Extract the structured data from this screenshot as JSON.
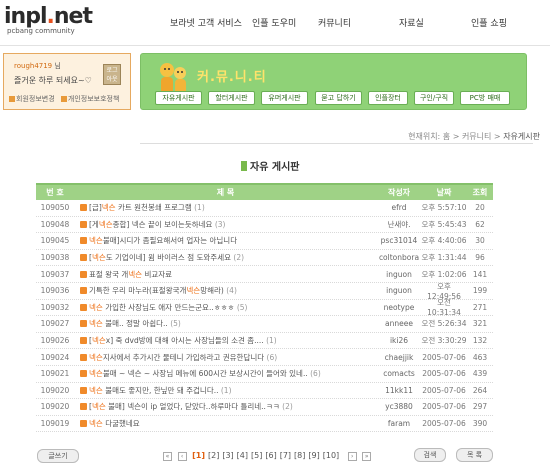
{
  "header": {
    "logo_main": "inpl",
    "logo_dot": ".",
    "logo_tld": "net",
    "logo_sub": "pcbang community",
    "nav": [
      "보라넷 고객 서비스",
      "인플 도우미",
      "커뮤니티",
      "자료실",
      "인플 쇼핑"
    ]
  },
  "login": {
    "username": "rough4719",
    "suffix": " 님",
    "greeting": "즐거운 하루 되세요~♡",
    "logout": "로그아웃",
    "link_info": "회원정보변경",
    "link_privacy": "개인정보보호정책"
  },
  "banner": {
    "title": "커.뮤.니.티",
    "tabs": [
      "자유게시판",
      "할터게시판",
      "유머게시판",
      "묻고 답하기",
      "인플장터",
      "구인/구직",
      "PC방 매매"
    ]
  },
  "breadcrumb": {
    "prefix": "현재위치:",
    "path": "홈 > 커뮤니티 > ",
    "current": "자유게시판"
  },
  "board": {
    "title": "자유 게시판",
    "columns": [
      "번 호",
      "제 목",
      "작성자",
      "날짜",
      "조회"
    ],
    "rows": [
      {
        "no": "109050",
        "pre": "[급]",
        "hl": "넥슨",
        "post": " 카트 원천봉쇄 프로그램",
        "cmt": "(1)",
        "writer": "efrd",
        "date": "오후 5:57:10",
        "hits": "20"
      },
      {
        "no": "109048",
        "pre": "[게",
        "hl": "넥슨",
        "post": "종합] 넥슨 끝이 보이는듯하네요",
        "cmt": "(3)",
        "writer": "난새야.",
        "date": "오후 5:45:43",
        "hits": "62"
      },
      {
        "no": "109045",
        "pre": "",
        "hl": "넥슨",
        "post": "불매]시디가 좀필요해서여 업자는 아닙니다",
        "cmt": "",
        "writer": "psc31014",
        "date": "오후 4:40:06",
        "hits": "30"
      },
      {
        "no": "109038",
        "pre": "[",
        "hl": "넥슨",
        "post": "도 기업이네] 윔 바이러스 점 도와주세요",
        "cmt": "(2)",
        "writer": "coltonbora",
        "date": "오후 1:31:44",
        "hits": "96"
      },
      {
        "no": "109037",
        "pre": "표절 왕국 개",
        "hl": "넥슨",
        "post": " 비교자료",
        "cmt": "",
        "writer": "inguon",
        "date": "오후 1:02:06",
        "hits": "141"
      },
      {
        "no": "109036",
        "pre": "기특한 우리 마누라(표절왕국개",
        "hl": "넥슨",
        "post": "망해라)",
        "cmt": "(4)",
        "writer": "inguon",
        "date": "오후 12:49:56",
        "hits": "199"
      },
      {
        "no": "109032",
        "pre": "",
        "hl": "넥슨",
        "post": " 가입한 사장님도 애자 만드는군요..ㅎㅎㅎ",
        "cmt": "(5)",
        "writer": "neotype",
        "date": "오전 10:31:34",
        "hits": "271"
      },
      {
        "no": "109027",
        "pre": "",
        "hl": "넥슨",
        "post": " 불매.. 정말 아쉽다..",
        "cmt": "(5)",
        "writer": "anneee",
        "date": "오전 5:26:34",
        "hits": "321"
      },
      {
        "no": "109026",
        "pre": "[",
        "hl": "넥슨",
        "post": "x] 죽 dvd방에 대해 아시는 사장님들의 소견 좀....",
        "cmt": "(1)",
        "writer": "iki26",
        "date": "오전 3:30:29",
        "hits": "132"
      },
      {
        "no": "109024",
        "pre": "",
        "hl": "넥슨",
        "post": "지사에서 추가시간 물테니 가입하라고 권유한답니다",
        "cmt": "(6)",
        "writer": "chaejjik",
        "date": "2005-07-06",
        "hits": "463"
      },
      {
        "no": "109021",
        "pre": "",
        "hl": "넥슨",
        "post": "불매 ~ 넥슨 ~ 사장님 메뉴에 600시간 보상시간이 들어와 있네..",
        "cmt": "(6)",
        "writer": "comacts",
        "date": "2005-07-06",
        "hits": "439"
      },
      {
        "no": "109020",
        "pre": "",
        "hl": "넥슨",
        "post": " 불매도 좋지만, 한닢만 돼 주겁니다..",
        "cmt": "(1)",
        "writer": "11kk11",
        "date": "2005-07-06",
        "hits": "264"
      },
      {
        "no": "109020",
        "pre": "[",
        "hl": "넥슨",
        "post": " 불매] 넥슨이 ip 얼었다, 닫았다..하루마다 틀리네..ㅋㅋ",
        "cmt": "(2)",
        "writer": "yc3880",
        "date": "2005-07-06",
        "hits": "297"
      },
      {
        "no": "109019",
        "pre": "",
        "hl": "넥슨",
        "post": " 다굴했네요",
        "cmt": "",
        "writer": "faram",
        "date": "2005-07-06",
        "hits": "390"
      }
    ]
  },
  "footer": {
    "write": "글쓰기",
    "pages": [
      "[1]",
      "[2]",
      "[3]",
      "[4]",
      "[5]",
      "[6]",
      "[7]",
      "[8]",
      "[9]",
      "[10]"
    ],
    "current_page": "[1]",
    "search": "검색",
    "list": "목 록"
  },
  "colors": {
    "accent_green": "#9fd286",
    "highlight_orange": "#ee6d12",
    "banner_green": "#8fd277"
  }
}
